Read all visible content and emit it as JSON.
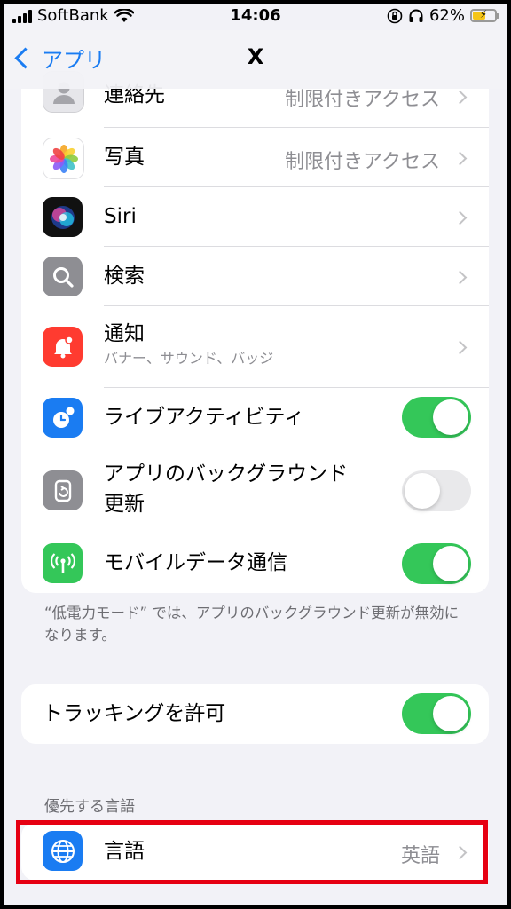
{
  "status_bar": {
    "carrier": "SoftBank",
    "time": "14:06",
    "battery_percent": "62%",
    "battery_level": 0.62
  },
  "nav": {
    "back_label": "アプリ",
    "title": "X"
  },
  "permissions": [
    {
      "id": "contacts",
      "label": "連絡先",
      "value": "制限付きアクセス",
      "icon": "contacts-icon"
    },
    {
      "id": "photos",
      "label": "写真",
      "value": "制限付きアクセス",
      "icon": "photos-icon"
    },
    {
      "id": "siri",
      "label": "Siri",
      "icon": "siri-icon"
    },
    {
      "id": "search",
      "label": "検索",
      "icon": "search-icon"
    },
    {
      "id": "notifications",
      "label": "通知",
      "sublabel": "バナー、サウンド、バッジ",
      "icon": "notification-bell-icon"
    },
    {
      "id": "live-activities",
      "label": "ライブアクティビティ",
      "toggle": true,
      "icon": "live-activity-icon"
    },
    {
      "id": "background-refresh",
      "label": "アプリのバックグラウンド更新",
      "toggle": false,
      "icon": "background-refresh-icon"
    },
    {
      "id": "cellular-data",
      "label": "モバイルデータ通信",
      "toggle": true,
      "icon": "antenna-icon"
    }
  ],
  "low_power_note": "“低電力モード” では、アプリのバックグラウンド更新が無効になります。",
  "tracking": {
    "label": "トラッキングを許可",
    "toggle": true
  },
  "language_section": {
    "header": "優先する言語",
    "label": "言語",
    "value": "英語"
  },
  "colors": {
    "accent": "#1a7cf2",
    "toggle_on": "#34c759",
    "highlight": "#e60012"
  }
}
